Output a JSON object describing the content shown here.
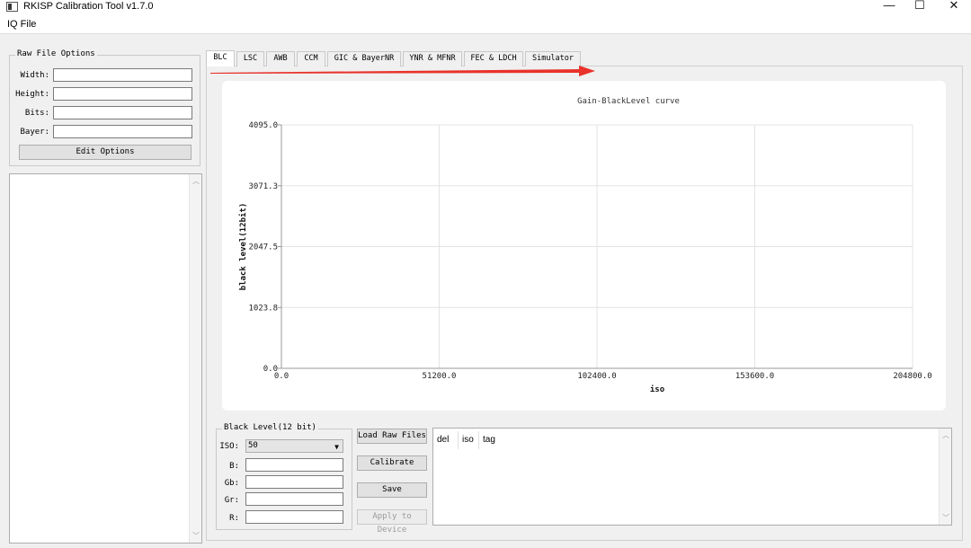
{
  "window": {
    "title": "RKISP Calibration Tool v1.7.0",
    "minimize_glyph": "—",
    "maximize_glyph": "☐",
    "close_glyph": "✕"
  },
  "menu": {
    "items": [
      "IQ File"
    ]
  },
  "raw_file_options": {
    "title": "Raw File Options",
    "fields": [
      {
        "label": "Width:",
        "value": ""
      },
      {
        "label": "Height:",
        "value": ""
      },
      {
        "label": "Bits:",
        "value": ""
      },
      {
        "label": "Bayer:",
        "value": ""
      }
    ],
    "edit_button": "Edit Options"
  },
  "tabs": [
    {
      "label": "BLC",
      "active": true
    },
    {
      "label": "LSC"
    },
    {
      "label": "AWB"
    },
    {
      "label": "CCM"
    },
    {
      "label": "GIC & BayerNR"
    },
    {
      "label": "YNR & MFNR"
    },
    {
      "label": "FEC & LDCH"
    },
    {
      "label": "Simulator"
    }
  ],
  "annotation_arrow_color": "#e8322b",
  "chart_data": {
    "type": "line",
    "title": "Gain-BlackLevel curve",
    "xlabel": "iso",
    "ylabel": "black level(12bit)",
    "xlim": [
      0,
      204800
    ],
    "ylim": [
      0,
      4095
    ],
    "xticks": [
      "0.0",
      "51200.0",
      "102400.0",
      "153600.0",
      "204800.0"
    ],
    "yticks": [
      "0.0",
      "1023.8",
      "2047.5",
      "3071.3",
      "4095.0"
    ],
    "grid": true,
    "series": []
  },
  "black_level": {
    "title": "Black Level(12 bit)",
    "iso_label": "ISO:",
    "iso_value": "50",
    "channels": [
      {
        "label": "B:",
        "value": ""
      },
      {
        "label": "Gb:",
        "value": ""
      },
      {
        "label": "Gr:",
        "value": ""
      },
      {
        "label": "R:",
        "value": ""
      }
    ]
  },
  "actions": {
    "load_raw": "Load Raw Files",
    "calibrate": "Calibrate",
    "save": "Save",
    "apply": "Apply to Device"
  },
  "result_table": {
    "columns": [
      "del",
      "iso",
      "tag"
    ],
    "rows": []
  }
}
